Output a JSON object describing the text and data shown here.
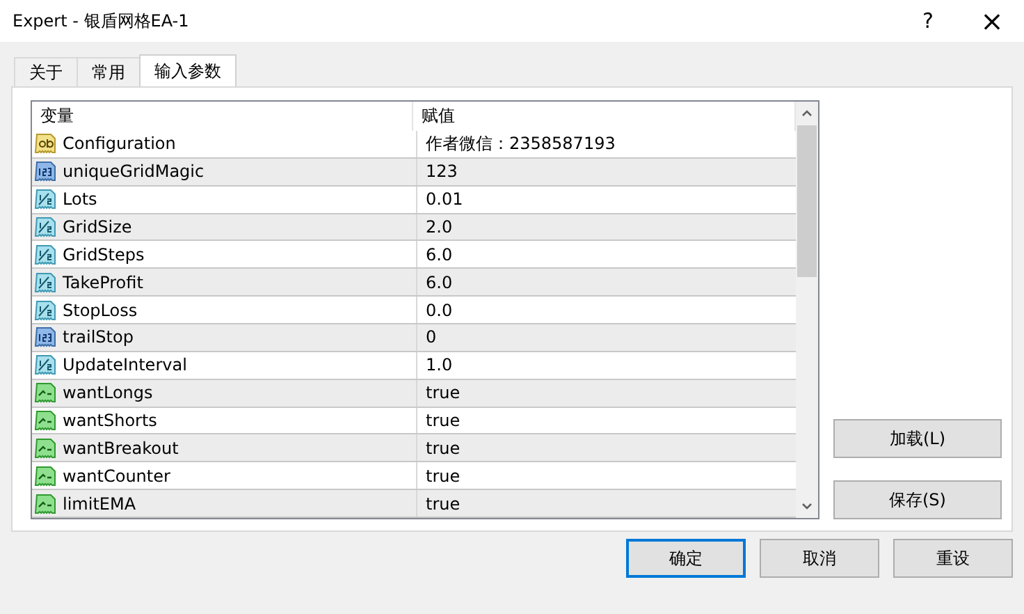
{
  "window": {
    "title": "Expert - 银盾网格EA-1",
    "help": "?",
    "close": "×"
  },
  "tabs": [
    {
      "label": "关于",
      "selected": false
    },
    {
      "label": "常用",
      "selected": false
    },
    {
      "label": "输入参数",
      "selected": true
    }
  ],
  "table": {
    "columns": [
      "变量",
      "赋值"
    ],
    "rows": [
      {
        "kind": "string",
        "name": "Configuration",
        "value": "作者微信：2358587193"
      },
      {
        "kind": "int",
        "name": "uniqueGridMagic",
        "value": "123"
      },
      {
        "kind": "double",
        "name": "Lots",
        "value": "0.01"
      },
      {
        "kind": "double",
        "name": "GridSize",
        "value": "2.0"
      },
      {
        "kind": "double",
        "name": "GridSteps",
        "value": "6.0"
      },
      {
        "kind": "double",
        "name": "TakeProfit",
        "value": "6.0"
      },
      {
        "kind": "double",
        "name": "StopLoss",
        "value": "0.0"
      },
      {
        "kind": "int",
        "name": "trailStop",
        "value": "0"
      },
      {
        "kind": "double",
        "name": "UpdateInterval",
        "value": "1.0"
      },
      {
        "kind": "bool",
        "name": "wantLongs",
        "value": "true"
      },
      {
        "kind": "bool",
        "name": "wantShorts",
        "value": "true"
      },
      {
        "kind": "bool",
        "name": "wantBreakout",
        "value": "true"
      },
      {
        "kind": "bool",
        "name": "wantCounter",
        "value": "true"
      },
      {
        "kind": "bool",
        "name": "limitEMA",
        "value": "true"
      }
    ]
  },
  "side_buttons": [
    "加载(L)",
    "保存(S)"
  ],
  "buttons": [
    {
      "label": "确定",
      "default": true
    },
    {
      "label": "取消",
      "default": false
    },
    {
      "label": "重设",
      "default": false
    }
  ]
}
